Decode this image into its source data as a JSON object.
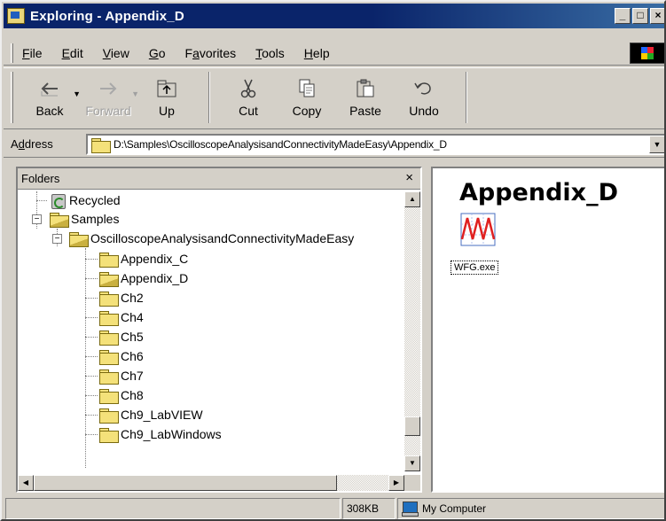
{
  "window": {
    "title": "Exploring - Appendix_D",
    "controls": [
      "_",
      "□",
      "×"
    ]
  },
  "menubar": {
    "items": [
      {
        "key": "F",
        "rest": "ile"
      },
      {
        "key": "E",
        "rest": "dit"
      },
      {
        "key": "V",
        "rest": "iew"
      },
      {
        "key": "G",
        "rest": "o"
      },
      {
        "pre": "F",
        "key": "a",
        "rest": "vorites"
      },
      {
        "key": "T",
        "rest": "ools"
      },
      {
        "key": "H",
        "rest": "elp"
      }
    ]
  },
  "toolbar": {
    "buttons": [
      {
        "label": "Back",
        "icon": "back-arrow-icon",
        "enabled": true,
        "dropdown": true
      },
      {
        "label": "Forward",
        "icon": "forward-arrow-icon",
        "enabled": false,
        "dropdown": true
      },
      {
        "label": "Up",
        "icon": "up-folder-icon",
        "enabled": true,
        "dropdown": false
      },
      {
        "label": "Cut",
        "icon": "scissors-icon",
        "enabled": true,
        "dropdown": false
      },
      {
        "label": "Copy",
        "icon": "copy-icon",
        "enabled": true,
        "dropdown": false
      },
      {
        "label": "Paste",
        "icon": "paste-icon",
        "enabled": true,
        "dropdown": false
      },
      {
        "label": "Undo",
        "icon": "undo-icon",
        "enabled": true,
        "dropdown": false
      }
    ]
  },
  "address": {
    "label_pre": "A",
    "label_key": "d",
    "label_rest": "dress",
    "value": "D:\\Samples\\OscilloscopeAnalysisandConnectivityMadeEasy\\Appendix_D"
  },
  "folders": {
    "header": "Folders",
    "close": "×",
    "items": [
      {
        "label": "Recycled",
        "icon": "recycle-bin-icon",
        "level": 1
      },
      {
        "label": "Samples",
        "icon": "folder-open-icon",
        "level": 0,
        "expander": "−"
      },
      {
        "label": "OscilloscopeAnalysisandConnectivityMadeEasy",
        "icon": "folder-open-icon",
        "level": 1,
        "expander": "−"
      },
      {
        "label": "Appendix_C",
        "icon": "folder-icon",
        "level": 2
      },
      {
        "label": "Appendix_D",
        "icon": "folder-open-icon",
        "level": 2
      },
      {
        "label": "Ch2",
        "icon": "folder-icon",
        "level": 2
      },
      {
        "label": "Ch4",
        "icon": "folder-icon",
        "level": 2
      },
      {
        "label": "Ch5",
        "icon": "folder-icon",
        "level": 2
      },
      {
        "label": "Ch6",
        "icon": "folder-icon",
        "level": 2
      },
      {
        "label": "Ch7",
        "icon": "folder-icon",
        "level": 2
      },
      {
        "label": "Ch8",
        "icon": "folder-icon",
        "level": 2
      },
      {
        "label": "Ch9_LabVIEW",
        "icon": "folder-icon",
        "level": 2
      },
      {
        "label": "Ch9_LabWindows",
        "icon": "folder-icon",
        "level": 2
      }
    ]
  },
  "content": {
    "title": "Appendix_D",
    "files": [
      {
        "label": "WFG.exe",
        "icon": "waveform-generator-icon"
      }
    ]
  },
  "statusbar": {
    "size": "308KB",
    "location": "My Computer"
  }
}
